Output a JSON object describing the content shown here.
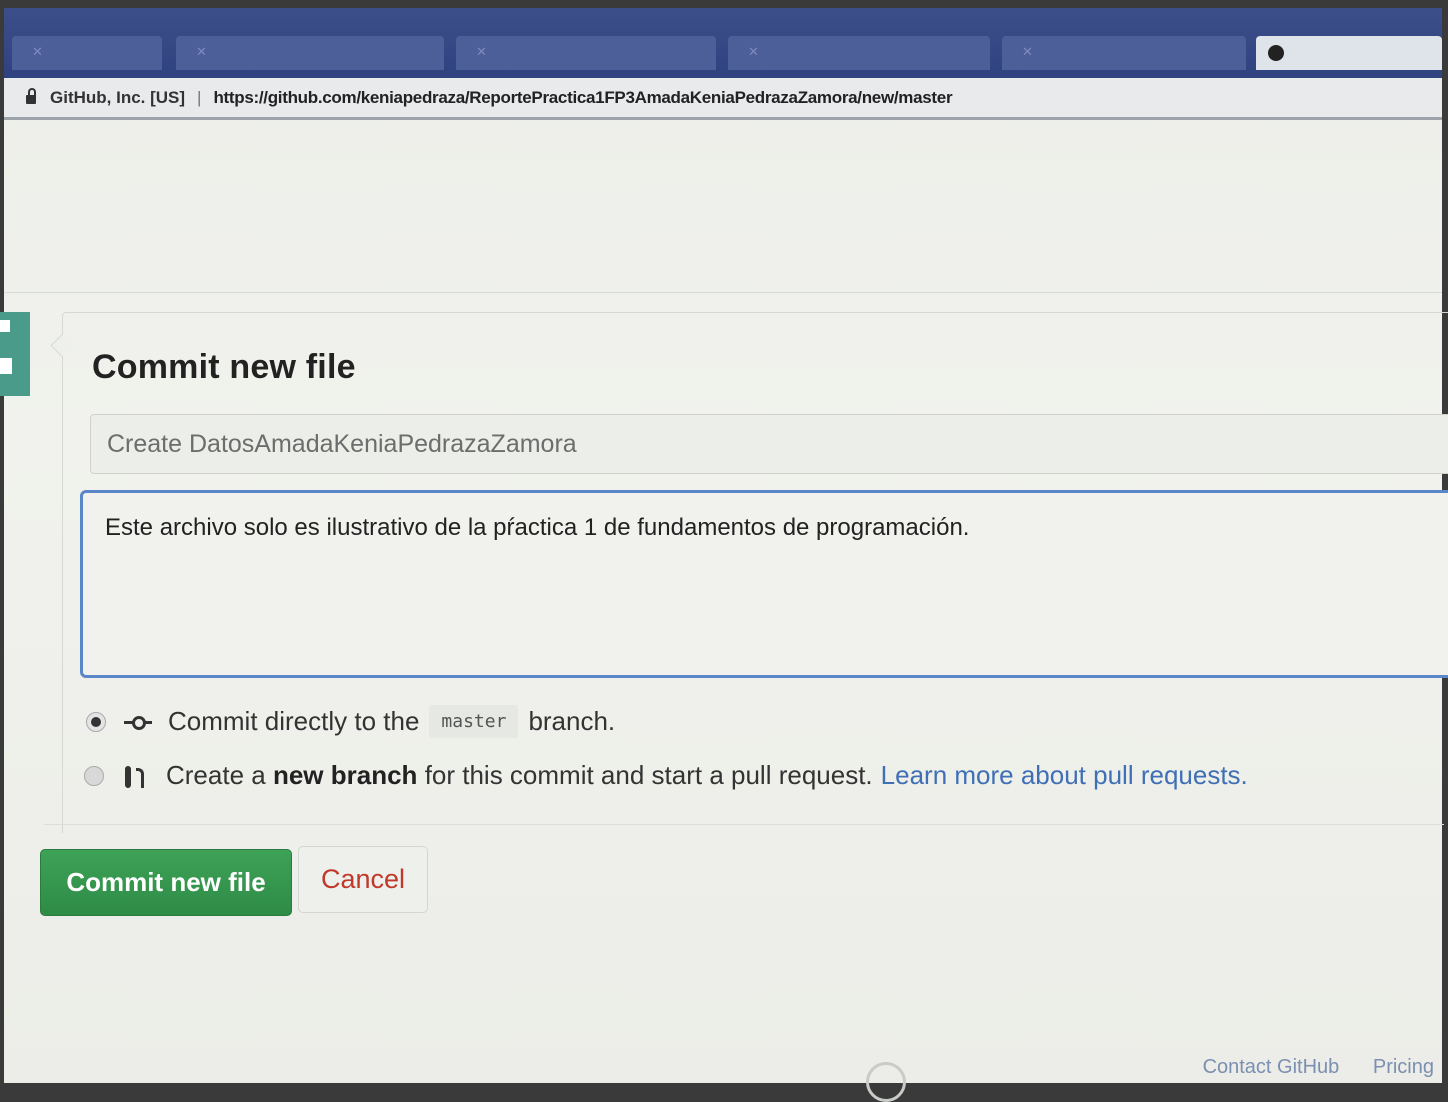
{
  "browser": {
    "tabs": [
      {
        "label": "",
        "active": false
      },
      {
        "label": "",
        "active": false
      },
      {
        "label": "",
        "active": false
      },
      {
        "label": "",
        "active": false
      },
      {
        "label": "",
        "active": false
      },
      {
        "label": "",
        "active": true
      }
    ],
    "cert_label": "GitHub, Inc. [US]",
    "url": "https://github.com/keniapedraza/ReportePractica1FP3AmadaKeniaPedrazaZamora/new/master"
  },
  "commit": {
    "title": "Commit new file",
    "summary_placeholder": "Create DatosAmadaKeniaPedrazaZamora",
    "description_value": "Este archivo solo es ilustrativo de la pŕactica 1 de fundamentos de programación.",
    "option_direct": {
      "prefix": "Commit directly to the",
      "branch": "master",
      "suffix": "branch.",
      "selected": true
    },
    "option_new_branch": {
      "prefix": "Create a",
      "bold": "new branch",
      "suffix": "for this commit and start a pull request.",
      "link": "Learn more about pull requests.",
      "selected": false
    },
    "commit_button": "Commit new file",
    "cancel_button": "Cancel"
  },
  "footer": {
    "right_links": [
      "Contact GitHub",
      "Pricing"
    ],
    "left_links": [
      "",
      "",
      ""
    ]
  },
  "colors": {
    "primary_green": "#2e8b46",
    "link_blue": "#3f6fb5",
    "cancel_red": "#c0392b",
    "focus_blue": "#5b86c8"
  }
}
